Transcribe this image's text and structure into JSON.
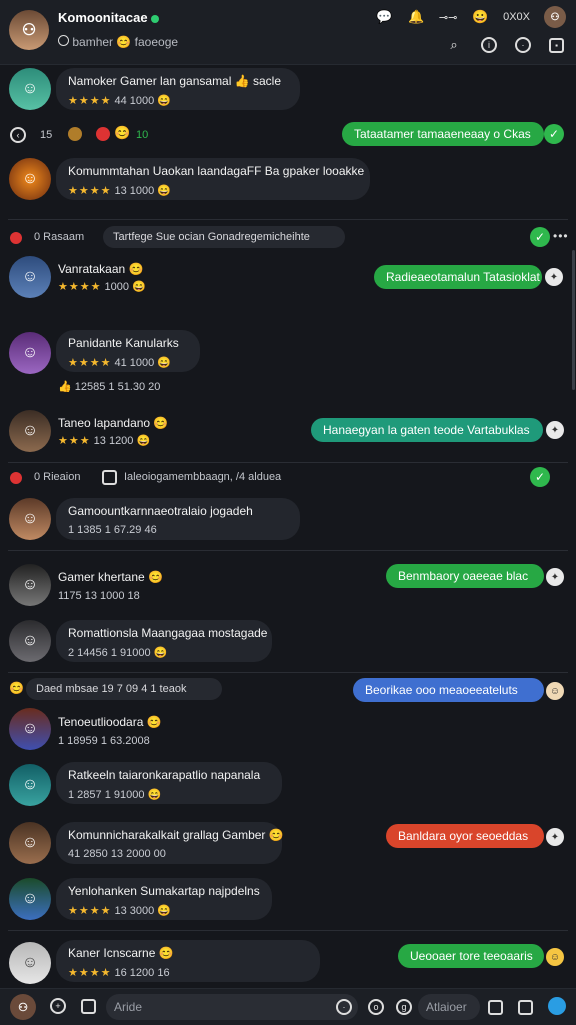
{
  "header": {
    "title": "Komoonitacae",
    "subtitle": "bamher",
    "subtitle_extra": "faoeoge",
    "top_icons": [
      "notification-badge-icon",
      "bell-icon",
      "link-icon",
      "emoji-icon"
    ],
    "top_right_text": "0X0X",
    "action_icons": [
      "search-icon",
      "info-icon",
      "clock-icon",
      "square-icon"
    ]
  },
  "colors": {
    "bg": "#15171c",
    "bubble": "#23262d",
    "green": "#27a844",
    "teal": "#1f9a7a",
    "blue": "#3f6fd0",
    "red": "#d9452b",
    "star": "#f5b82e"
  },
  "messages": [
    {
      "name": "Namoker Gamer lan gansamal 👍 sacle",
      "meta": "44 1000 😄",
      "stars": "★★★★"
    },
    {
      "name": "Komummtahan Uaokan laandagaFF Ba gpaker looakke",
      "meta": "13 1000 😄",
      "stars": "★★★★"
    },
    {
      "name": "Vanratakaan 😊",
      "meta": "1000 😄",
      "stars": "★★★★"
    },
    {
      "name": "Panidante Kanularks",
      "meta": "41 1000 😄",
      "stars": "★★★★"
    },
    {
      "name": "Taneo lapandano 😊",
      "meta": "13 1200 😄",
      "stars": "★★★"
    },
    {
      "name": "Gamoountkarnnaeotralaio jogadeh",
      "meta": "1 1385 1 67.29 46",
      "stars": ""
    },
    {
      "name": "Gamer khertane 😊",
      "meta": "1175 13 1000 18",
      "stars": ""
    },
    {
      "name": "Romattionsla Maangagaa mostagade",
      "meta": "2 14456 1 91000 😄",
      "stars": ""
    },
    {
      "name": "Tenoeutlioodara 😊",
      "meta": "1 18959 1 63.2008",
      "stars": ""
    },
    {
      "name": "Ratkeeln taiaronkarapatlio napanala",
      "meta": "1 2857 1 91000 😄",
      "stars": ""
    },
    {
      "name": "Komunnicharakalkait grallag Gamber 😊",
      "meta": "41 2850 13 2000 00",
      "stars": ""
    },
    {
      "name": "Yenlohanken Sumakartap najpdelns",
      "meta": "13 3000 😄",
      "stars": "★★★★"
    },
    {
      "name": "Kaner Icnscarne 😊",
      "meta": "16 1200 16",
      "stars": "★★★★"
    }
  ],
  "sent": [
    "Tataatamer tamaaeneaay o Ckas",
    "Radieaeotamalun Tatasioklat",
    "Hanaegyan la gaten teode Vartabuklas",
    "Benmbaory oaeeae blac",
    "Beorikae ooo meaoeeateluts",
    "Banldara oyor seoeddas",
    "Ueooaer tore teeoaaris"
  ],
  "status_row": {
    "left": "15",
    "mid": "10"
  },
  "system": [
    {
      "left": "0 Rasaam",
      "pill": "Tartfege Sue ocian Gonadregemicheihte"
    },
    {
      "left": "0 Rieaion",
      "text": "Ialeoiogamembbaagn, /4 alduea"
    },
    {
      "left": "Daed mbsae",
      "text": "19 7 09 4 1 teaok"
    }
  ],
  "bottom": {
    "input_placeholder": "Aride",
    "input2_placeholder": "Atlaioer"
  }
}
